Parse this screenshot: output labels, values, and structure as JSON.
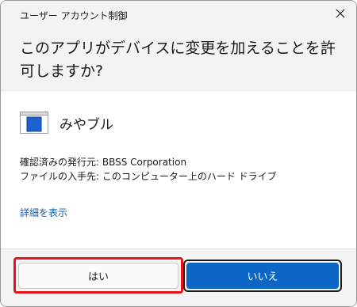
{
  "dialog": {
    "title": "ユーザー アカウント制御",
    "question": "このアプリがデバイスに変更を加えることを許可しますか?",
    "app_name": "みやブル",
    "publisher_line": "確認済みの発行元: BBSS Corporation",
    "origin_line": "ファイルの入手先: このコンピューター上のハード ドライブ",
    "more_details_label": "詳細を表示",
    "yes_label": "はい",
    "no_label": "いいえ",
    "icons": [
      "close-icon",
      "app-icon"
    ],
    "colors": {
      "accent": "#0b66c5",
      "link": "#0f5bb5",
      "highlight": "#e6141a",
      "header_bg": "#f3f3f3"
    }
  }
}
